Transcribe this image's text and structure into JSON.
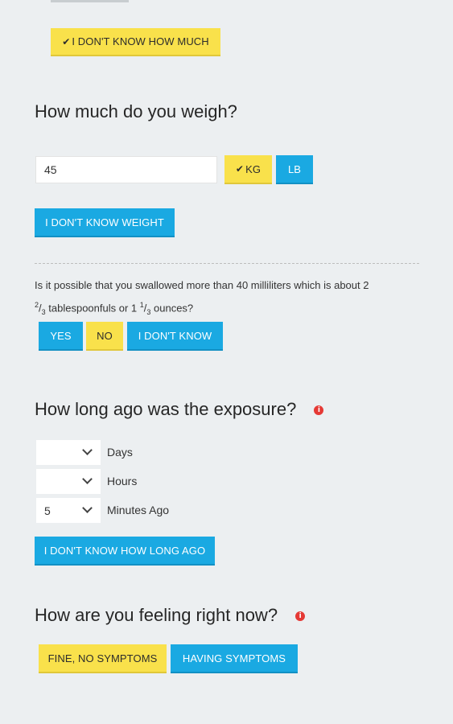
{
  "previous": {
    "dont_know_amount": "I DON'T KNOW HOW MUCH"
  },
  "weight": {
    "heading": "How much do you weigh?",
    "value": "45",
    "kg_label": "KG",
    "lb_label": "LB",
    "dont_know": "I DON'T KNOW WEIGHT"
  },
  "swallow": {
    "question_part1": "Is it possible that you swallowed more than 40 milliliters which is about 2",
    "frac1_num": "2",
    "frac1_den": "3",
    "question_part2": " tablespoonfuls or 1 ",
    "frac2_num": "1",
    "frac2_den": "3",
    "question_part3": " ounces?",
    "yes": "YES",
    "no": "NO",
    "dont_know": "I DON'T KNOW"
  },
  "exposure": {
    "heading": "How long ago was the exposure?",
    "info_icon": "info-icon",
    "days_value": "",
    "days_label": "Days",
    "hours_value": "",
    "hours_label": "Hours",
    "minutes_value": "5",
    "minutes_label": "Minutes Ago",
    "dont_know": "I DON'T KNOW HOW LONG AGO"
  },
  "feeling": {
    "heading": "How are you feeling right now?",
    "info_icon": "info-icon",
    "fine": "FINE, NO SYMPTOMS",
    "symptoms": "HAVING SYMPTOMS"
  },
  "colors": {
    "background": "#eceff1",
    "blue_button": "#1aa9e2",
    "yellow_button": "#f9e14b",
    "info_icon": "#e53935"
  }
}
